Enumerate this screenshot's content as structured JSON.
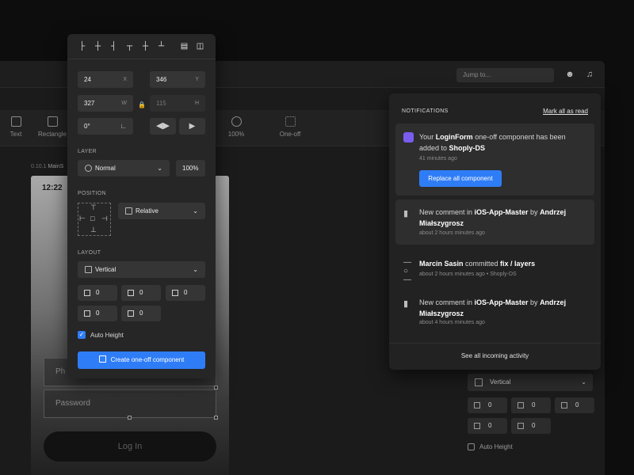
{
  "topbar": {
    "jump_placeholder": "Jump to...",
    "icons": [
      "user-icon",
      "bell-icon"
    ]
  },
  "toolbar": {
    "tools": [
      {
        "label": "Text",
        "icon": "text-icon"
      },
      {
        "label": "Rectangle",
        "icon": "rectangle-icon"
      },
      {
        "label": "100%",
        "icon": "zoom-icon"
      },
      {
        "label": "One-off",
        "icon": "component-icon"
      }
    ]
  },
  "canvas": {
    "frame_label_prefix": "0.10.1",
    "frame_label": "MainS",
    "phone_time": "12:22",
    "password_placeholder": "Password",
    "email_placeholder": "Ph",
    "login_label": "Log In"
  },
  "design_panel": {
    "x": "24",
    "x_suffix": "X",
    "y": "346",
    "y_suffix": "Y",
    "w": "327",
    "w_suffix": "W",
    "h": "115",
    "h_suffix": "H",
    "rotation": "0°",
    "layer_title": "LAYER",
    "blend_mode": "Normal",
    "opacity": "100%",
    "position_title": "POSITION",
    "position_mode": "Relative",
    "layout_title": "LAYOUT",
    "layout_mode": "Vertical",
    "paddings": [
      "0",
      "0",
      "0",
      "0",
      "0"
    ],
    "auto_height_label": "Auto Height",
    "auto_height_checked": true,
    "create_button": "Create one-off component",
    "accent": "#2f7df6"
  },
  "notifications": {
    "title": "NOTIFICATIONS",
    "mark_all": "Mark all as read",
    "items": [
      {
        "pre": "Your ",
        "bold1": "LoginForm",
        "mid": " one-off component has been added to ",
        "bold2": "Shoply-DS",
        "post": "",
        "time": "41 minutes ago",
        "action": "Replace all component",
        "icon": "component-icon"
      },
      {
        "pre": "New comment in ",
        "bold1": "iOS-App-Master",
        "mid": " by ",
        "bold2": "Andrzej Miałszygrosz",
        "post": "",
        "time": "about 2 hours minutes ago",
        "icon": "comment-icon"
      },
      {
        "pre": "",
        "bold1": "Marcin Sasin",
        "mid": " committed ",
        "bold2": "fix / layers",
        "post": "",
        "time": "about 2 hours minutes ago • Shoply-DS",
        "icon": "commit-icon"
      },
      {
        "pre": "New comment in ",
        "bold1": "iOS-App-Master",
        "mid": " by ",
        "bold2": "Andrzej Miałszygrosz",
        "post": "",
        "time": "about 4 hours minutes ago",
        "icon": "comment-icon"
      }
    ],
    "see_all": "See all incoming activity"
  },
  "bg_layout": {
    "mode": "Vertical",
    "paddings": [
      "0",
      "0",
      "0",
      "0",
      "0"
    ],
    "auto_height_label": "Auto Height"
  }
}
